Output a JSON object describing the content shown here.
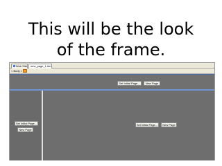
{
  "slide": {
    "title_line1": "This will be the look",
    "title_line2": "of the frame."
  },
  "browser": {
    "tabs": [
      {
        "label": "Web Site"
      },
      {
        "label": "new_page_1.htm"
      }
    ],
    "toolbar": {
      "back_label": "< Body >"
    }
  },
  "frames": {
    "top": {
      "set_initial_label": "Set Initial Page...",
      "new_page_label": "New Page"
    },
    "left": {
      "set_initial_label": "Set Initial Page...",
      "new_page_label": "New Page"
    },
    "right": {
      "set_initial_label": "Set Initial Page...",
      "new_page_label": "New Page"
    }
  }
}
